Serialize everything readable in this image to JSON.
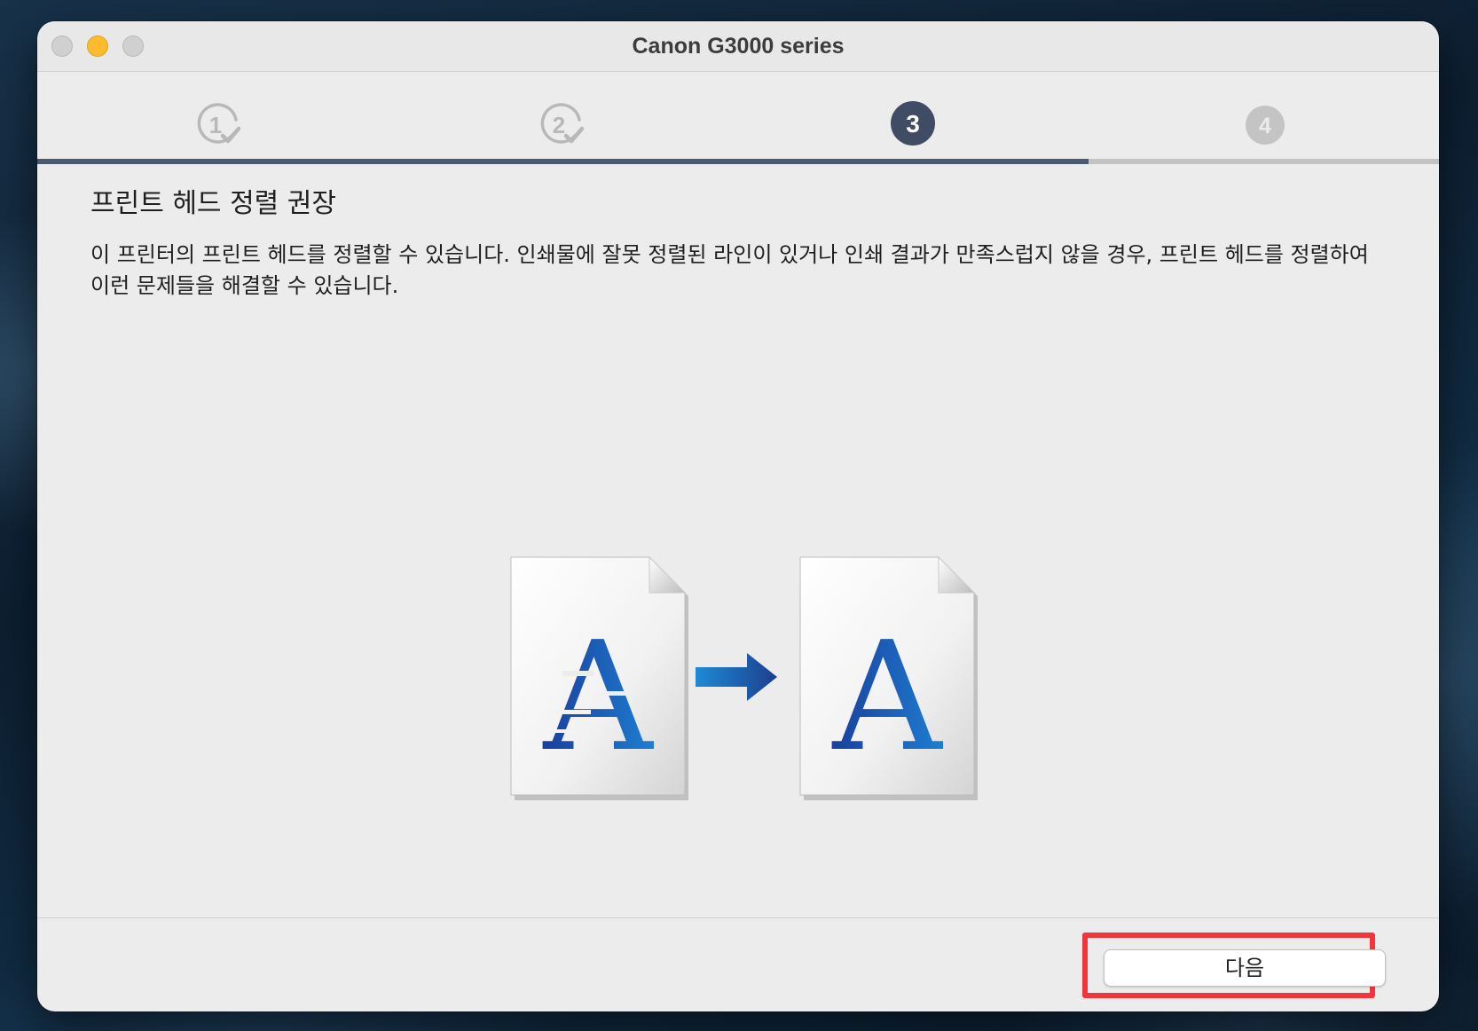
{
  "window": {
    "title": "Canon G3000 series"
  },
  "steps": {
    "current": 3,
    "items": [
      {
        "number": "1",
        "state": "completed"
      },
      {
        "number": "2",
        "state": "completed"
      },
      {
        "number": "3",
        "state": "current"
      },
      {
        "number": "4",
        "state": "upcoming"
      }
    ]
  },
  "progress": {
    "fraction": 0.75
  },
  "content": {
    "heading": "프린트 헤드 정렬 권장",
    "description": "이 프린터의 프린트 헤드를 정렬할 수 있습니다. 인쇄물에 잘못 정렬된 라인이 있거나 인쇄 결과가 만족스럽지 않을 경우, 프린트 헤드를 정렬하여 이런 문제들을 해결할 수 있습니다.",
    "illustration": {
      "before_letter": "A",
      "after_letter": "A",
      "icons": [
        "misaligned-document-icon",
        "arrow-right-icon",
        "aligned-document-icon"
      ]
    }
  },
  "footer": {
    "next_label": "다음"
  },
  "colors": {
    "window_bg": "#ececec",
    "step_current": "#3f4c63",
    "step_completed": "#b8b8b8",
    "step_upcoming": "#c4c4c4",
    "progress_fill": "#4b5a6e",
    "progress_track": "#c3c3c3",
    "highlight": "#f0353b",
    "letter_blue": "#1a55b0",
    "minimize_yellow": "#fdbc2e"
  }
}
